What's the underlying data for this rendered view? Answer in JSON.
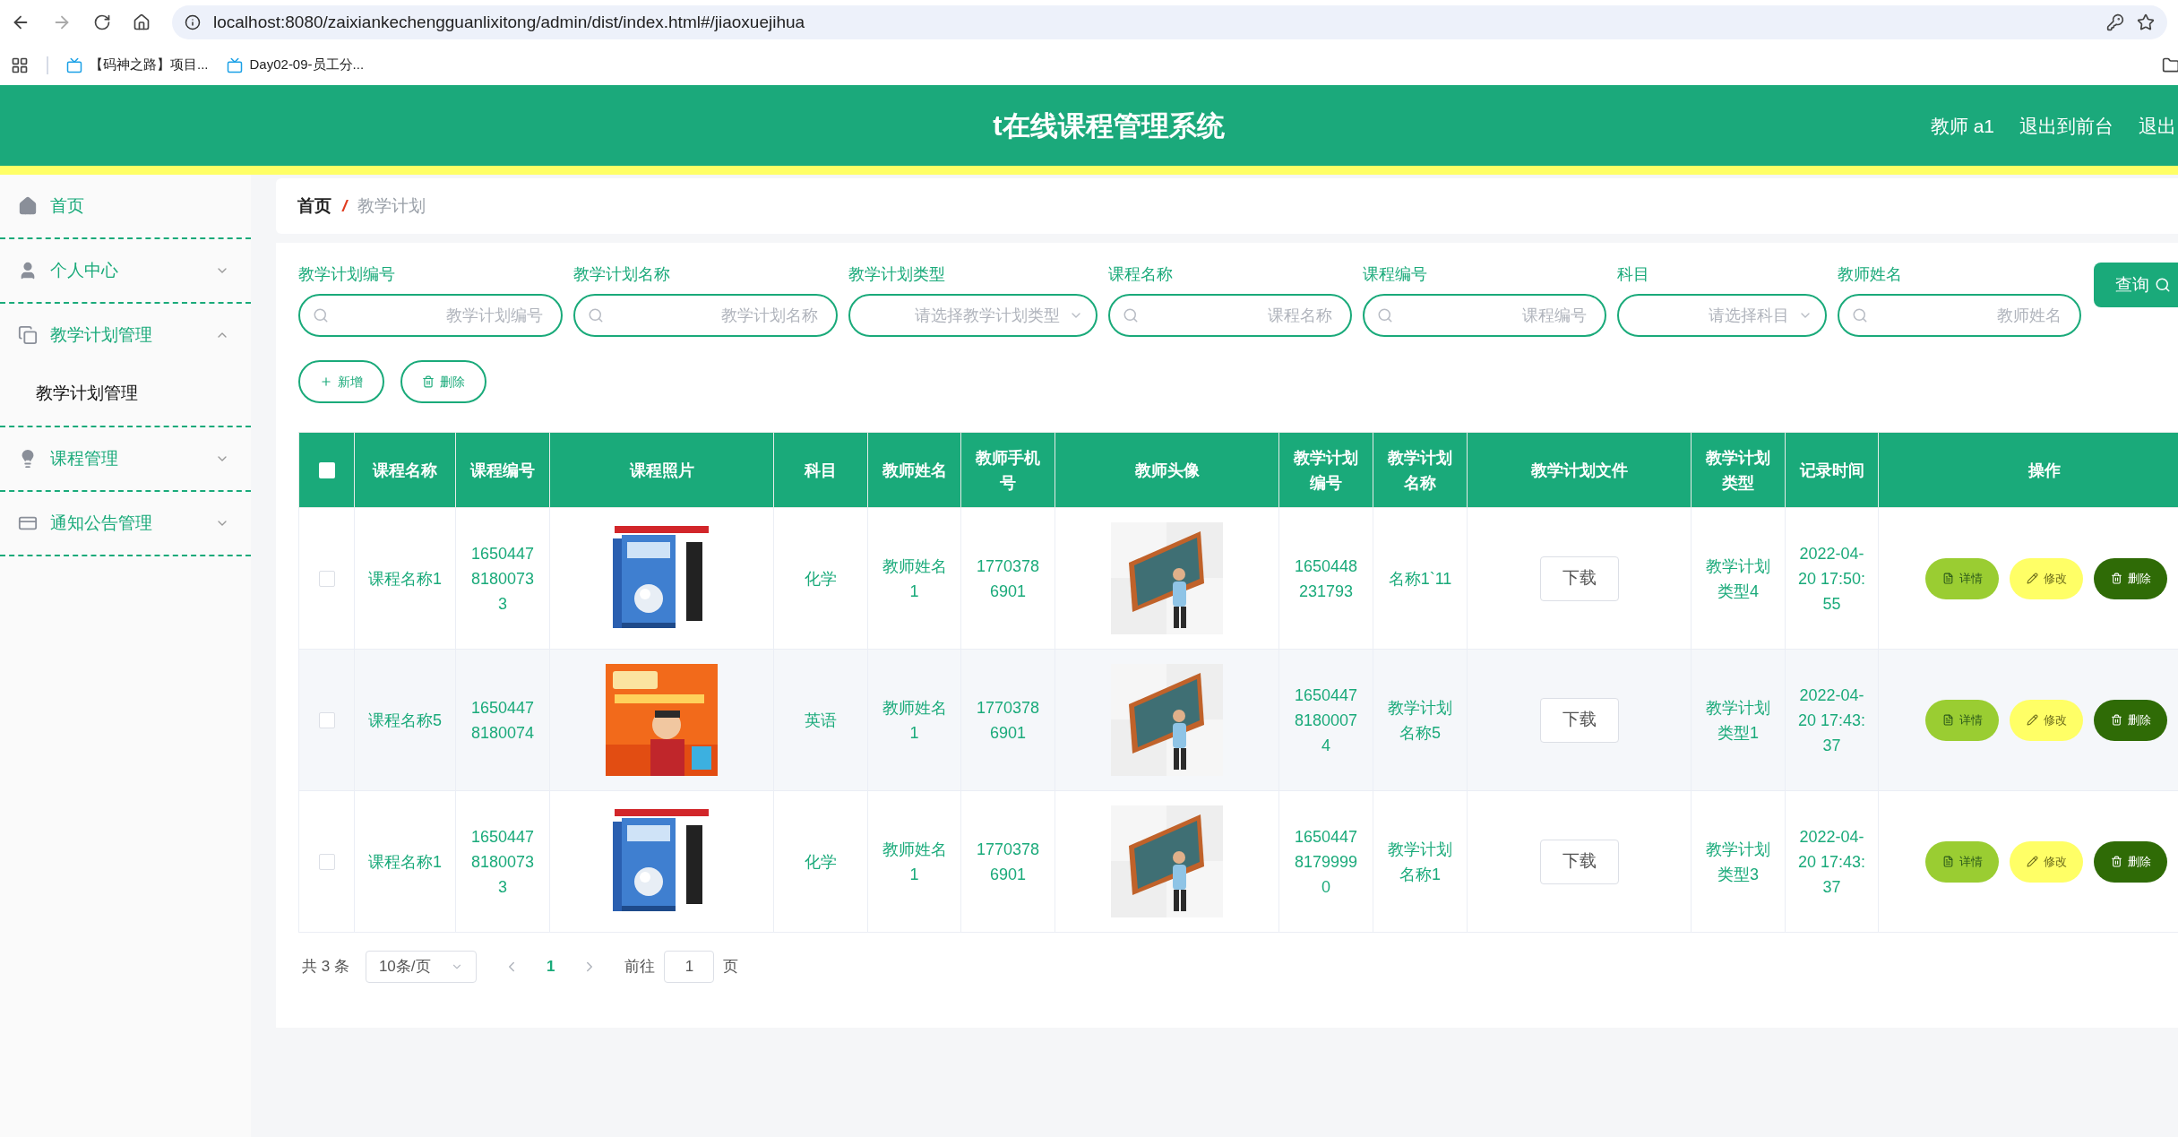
{
  "browser": {
    "url": "localhost:8080/zaixiankechengguanlixitong/admin/dist/index.html#/jiaoxuejihua",
    "bookmarks": [
      "【码神之路】项目...",
      "Day02-09-员工分..."
    ]
  },
  "header": {
    "title": "t在线课程管理系统",
    "links": [
      "教师 a1",
      "退出到前台",
      "退出"
    ]
  },
  "sidebar": {
    "items": [
      {
        "label": "首页",
        "kind": "link"
      },
      {
        "label": "个人中心",
        "kind": "menu",
        "expanded": false
      },
      {
        "label": "教学计划管理",
        "kind": "menu",
        "expanded": true,
        "children": [
          {
            "label": "教学计划管理"
          }
        ]
      },
      {
        "label": "课程管理",
        "kind": "menu",
        "expanded": false
      },
      {
        "label": "通知公告管理",
        "kind": "menu",
        "expanded": false
      }
    ]
  },
  "breadcrumb": [
    "首页",
    "/",
    "教学计划"
  ],
  "filters": [
    {
      "label": "教学计划编号",
      "placeholder": "教学计划编号",
      "kind": "input"
    },
    {
      "label": "教学计划名称",
      "placeholder": "教学计划名称",
      "kind": "input"
    },
    {
      "label": "教学计划类型",
      "placeholder": "请选择教学计划类型",
      "kind": "select"
    },
    {
      "label": "课程名称",
      "placeholder": "课程名称",
      "kind": "input"
    },
    {
      "label": "课程编号",
      "placeholder": "课程编号",
      "kind": "input"
    },
    {
      "label": "科目",
      "placeholder": "请选择科目",
      "kind": "select"
    },
    {
      "label": "教师姓名",
      "placeholder": "教师姓名",
      "kind": "input"
    }
  ],
  "query_button": "查询",
  "actions": [
    {
      "label": "新增",
      "kind": "add"
    },
    {
      "label": "删除",
      "kind": "delete"
    }
  ],
  "table": {
    "select_all_checked": false,
    "columns": [
      "课程名称",
      "课程编号",
      "课程照片",
      "科目",
      "教师姓名",
      "教师手机号",
      "教师头像",
      "教学计划编号",
      "教学计划名称",
      "教学计划文件",
      "教学计划类型",
      "记录时间",
      "操作"
    ],
    "rows": [
      {
        "checked": false,
        "course_name": "课程名称1",
        "course_no": "165044781800733",
        "subject": "化学",
        "teacher": "教师姓名1",
        "phone": "17703786901",
        "plan_no": "1650448231793",
        "plan_name": "名称1`11",
        "file": "下载",
        "plan_type": "教学计划类型4",
        "time": "2022-04-20 17:50:55",
        "buttons": [
          "详情",
          "修改",
          "删除"
        ]
      },
      {
        "checked": false,
        "course_name": "课程名称5",
        "course_no": "16504478180074",
        "subject": "英语",
        "teacher": "教师姓名1",
        "phone": "17703786901",
        "plan_no": "165044781800074",
        "plan_name": "教学计划名称5",
        "file": "下载",
        "plan_type": "教学计划类型1",
        "time": "2022-04-20 17:43:37",
        "buttons": [
          "详情",
          "修改",
          "删除"
        ]
      },
      {
        "checked": false,
        "course_name": "课程名称1",
        "course_no": "165044781800733",
        "subject": "化学",
        "teacher": "教师姓名1",
        "phone": "17703786901",
        "plan_no": "165044781799990",
        "plan_name": "教学计划名称1",
        "file": "下载",
        "plan_type": "教学计划类型3",
        "time": "2022-04-20 17:43:37",
        "buttons": [
          "详情",
          "修改",
          "删除"
        ]
      }
    ]
  },
  "pagination": {
    "total": "共 3 条",
    "page_size": "10条/页",
    "pages": [
      {
        "label": "1",
        "selected": true
      }
    ],
    "goto_label": "前往",
    "goto_value": "1",
    "goto_suffix": "页"
  }
}
